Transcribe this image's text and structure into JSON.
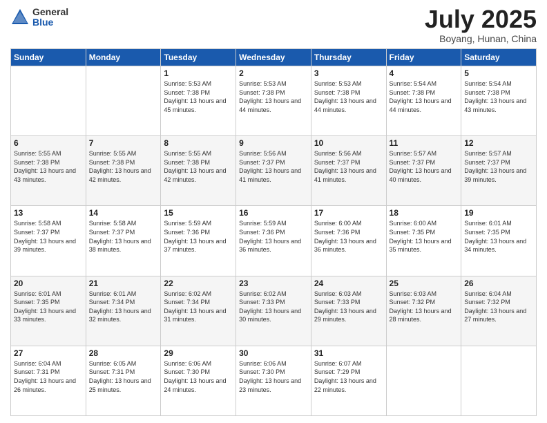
{
  "logo": {
    "general": "General",
    "blue": "Blue"
  },
  "title": "July 2025",
  "subtitle": "Boyang, Hunan, China",
  "weekdays": [
    "Sunday",
    "Monday",
    "Tuesday",
    "Wednesday",
    "Thursday",
    "Friday",
    "Saturday"
  ],
  "weeks": [
    [
      {
        "day": "",
        "info": ""
      },
      {
        "day": "",
        "info": ""
      },
      {
        "day": "1",
        "info": "Sunrise: 5:53 AM\nSunset: 7:38 PM\nDaylight: 13 hours and 45 minutes."
      },
      {
        "day": "2",
        "info": "Sunrise: 5:53 AM\nSunset: 7:38 PM\nDaylight: 13 hours and 44 minutes."
      },
      {
        "day": "3",
        "info": "Sunrise: 5:53 AM\nSunset: 7:38 PM\nDaylight: 13 hours and 44 minutes."
      },
      {
        "day": "4",
        "info": "Sunrise: 5:54 AM\nSunset: 7:38 PM\nDaylight: 13 hours and 44 minutes."
      },
      {
        "day": "5",
        "info": "Sunrise: 5:54 AM\nSunset: 7:38 PM\nDaylight: 13 hours and 43 minutes."
      }
    ],
    [
      {
        "day": "6",
        "info": "Sunrise: 5:55 AM\nSunset: 7:38 PM\nDaylight: 13 hours and 43 minutes."
      },
      {
        "day": "7",
        "info": "Sunrise: 5:55 AM\nSunset: 7:38 PM\nDaylight: 13 hours and 42 minutes."
      },
      {
        "day": "8",
        "info": "Sunrise: 5:55 AM\nSunset: 7:38 PM\nDaylight: 13 hours and 42 minutes."
      },
      {
        "day": "9",
        "info": "Sunrise: 5:56 AM\nSunset: 7:37 PM\nDaylight: 13 hours and 41 minutes."
      },
      {
        "day": "10",
        "info": "Sunrise: 5:56 AM\nSunset: 7:37 PM\nDaylight: 13 hours and 41 minutes."
      },
      {
        "day": "11",
        "info": "Sunrise: 5:57 AM\nSunset: 7:37 PM\nDaylight: 13 hours and 40 minutes."
      },
      {
        "day": "12",
        "info": "Sunrise: 5:57 AM\nSunset: 7:37 PM\nDaylight: 13 hours and 39 minutes."
      }
    ],
    [
      {
        "day": "13",
        "info": "Sunrise: 5:58 AM\nSunset: 7:37 PM\nDaylight: 13 hours and 39 minutes."
      },
      {
        "day": "14",
        "info": "Sunrise: 5:58 AM\nSunset: 7:37 PM\nDaylight: 13 hours and 38 minutes."
      },
      {
        "day": "15",
        "info": "Sunrise: 5:59 AM\nSunset: 7:36 PM\nDaylight: 13 hours and 37 minutes."
      },
      {
        "day": "16",
        "info": "Sunrise: 5:59 AM\nSunset: 7:36 PM\nDaylight: 13 hours and 36 minutes."
      },
      {
        "day": "17",
        "info": "Sunrise: 6:00 AM\nSunset: 7:36 PM\nDaylight: 13 hours and 36 minutes."
      },
      {
        "day": "18",
        "info": "Sunrise: 6:00 AM\nSunset: 7:35 PM\nDaylight: 13 hours and 35 minutes."
      },
      {
        "day": "19",
        "info": "Sunrise: 6:01 AM\nSunset: 7:35 PM\nDaylight: 13 hours and 34 minutes."
      }
    ],
    [
      {
        "day": "20",
        "info": "Sunrise: 6:01 AM\nSunset: 7:35 PM\nDaylight: 13 hours and 33 minutes."
      },
      {
        "day": "21",
        "info": "Sunrise: 6:01 AM\nSunset: 7:34 PM\nDaylight: 13 hours and 32 minutes."
      },
      {
        "day": "22",
        "info": "Sunrise: 6:02 AM\nSunset: 7:34 PM\nDaylight: 13 hours and 31 minutes."
      },
      {
        "day": "23",
        "info": "Sunrise: 6:02 AM\nSunset: 7:33 PM\nDaylight: 13 hours and 30 minutes."
      },
      {
        "day": "24",
        "info": "Sunrise: 6:03 AM\nSunset: 7:33 PM\nDaylight: 13 hours and 29 minutes."
      },
      {
        "day": "25",
        "info": "Sunrise: 6:03 AM\nSunset: 7:32 PM\nDaylight: 13 hours and 28 minutes."
      },
      {
        "day": "26",
        "info": "Sunrise: 6:04 AM\nSunset: 7:32 PM\nDaylight: 13 hours and 27 minutes."
      }
    ],
    [
      {
        "day": "27",
        "info": "Sunrise: 6:04 AM\nSunset: 7:31 PM\nDaylight: 13 hours and 26 minutes."
      },
      {
        "day": "28",
        "info": "Sunrise: 6:05 AM\nSunset: 7:31 PM\nDaylight: 13 hours and 25 minutes."
      },
      {
        "day": "29",
        "info": "Sunrise: 6:06 AM\nSunset: 7:30 PM\nDaylight: 13 hours and 24 minutes."
      },
      {
        "day": "30",
        "info": "Sunrise: 6:06 AM\nSunset: 7:30 PM\nDaylight: 13 hours and 23 minutes."
      },
      {
        "day": "31",
        "info": "Sunrise: 6:07 AM\nSunset: 7:29 PM\nDaylight: 13 hours and 22 minutes."
      },
      {
        "day": "",
        "info": ""
      },
      {
        "day": "",
        "info": ""
      }
    ]
  ]
}
